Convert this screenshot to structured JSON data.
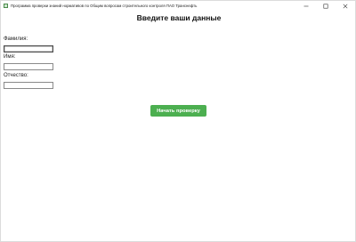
{
  "window": {
    "title": "Программа проверки знаний нормативов по Общим вопросам строительного контроля ПАО Транснефть",
    "minimize_glyph": "—",
    "close_glyph": "✕"
  },
  "form": {
    "heading": "Введите ваши данные",
    "fields": [
      {
        "label": "Фамилия:",
        "value": ""
      },
      {
        "label": "Имя:",
        "value": ""
      },
      {
        "label": "Отчество:",
        "value": ""
      }
    ],
    "start_button_label": "Начать проверку"
  },
  "colors": {
    "accent": "#4caf50"
  }
}
